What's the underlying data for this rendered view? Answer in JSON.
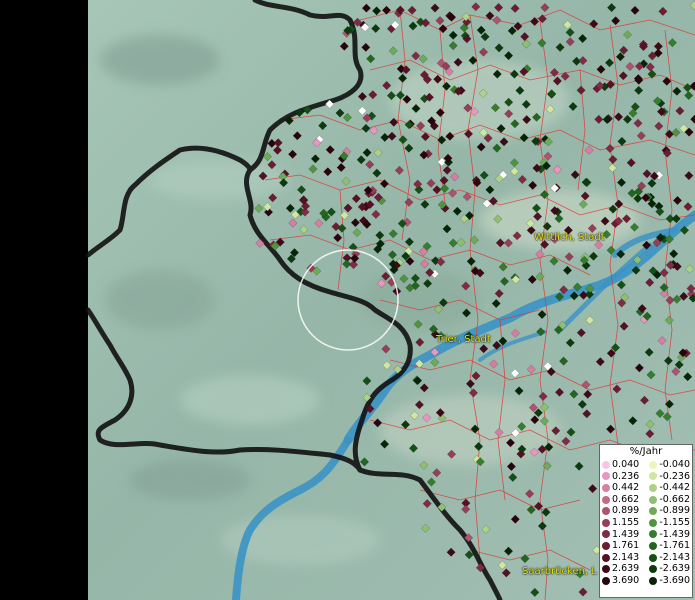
{
  "places": [
    {
      "name": "Wittlich, Stadt"
    },
    {
      "name": "Trier, Stadt"
    },
    {
      "name": "Saarbrücken, L"
    }
  ],
  "legend": {
    "title": "%/Jahr",
    "positive": [
      {
        "value": "0.040",
        "color": "#f7c6e6"
      },
      {
        "value": "0.236",
        "color": "#e996c2"
      },
      {
        "value": "0.442",
        "color": "#d67fa3"
      },
      {
        "value": "0.662",
        "color": "#c26a87"
      },
      {
        "value": "0.899",
        "color": "#ad5470"
      },
      {
        "value": "1.155",
        "color": "#973e59"
      },
      {
        "value": "1.439",
        "color": "#822b45"
      },
      {
        "value": "1.761",
        "color": "#6c1c33"
      },
      {
        "value": "2.143",
        "color": "#561224"
      },
      {
        "value": "2.639",
        "color": "#3f0a17"
      },
      {
        "value": "3.690",
        "color": "#2a040c"
      }
    ],
    "negative": [
      {
        "value": "-0.040",
        "color": "#eef5b8"
      },
      {
        "value": "-0.236",
        "color": "#cfe7a0"
      },
      {
        "value": "-0.442",
        "color": "#aed18a"
      },
      {
        "value": "-0.662",
        "color": "#8fbf72"
      },
      {
        "value": "-0.899",
        "color": "#6eab58"
      },
      {
        "value": "-1.155",
        "color": "#4f9540"
      },
      {
        "value": "-1.439",
        "color": "#357e2e"
      },
      {
        "value": "-1.761",
        "color": "#22661f"
      },
      {
        "value": "-2.143",
        "color": "#145014"
      },
      {
        "value": "-2.639",
        "color": "#0c3a0c"
      },
      {
        "value": "-3.690",
        "color": "#062506"
      }
    ]
  },
  "colors": {
    "terrain": "#9bbcae",
    "water": "#3b93c4",
    "border": "#111111",
    "district_lines": "#e0312c",
    "label": "#e8e300"
  },
  "icons": [
    "selection-circle-icon"
  ]
}
